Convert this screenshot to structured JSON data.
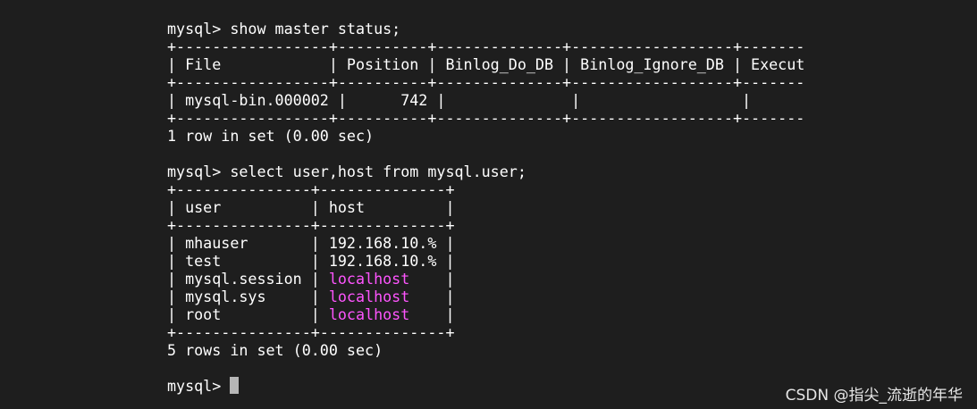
{
  "terminal": {
    "prompt": "mysql> ",
    "colors": {
      "background": "#1e1e1e",
      "text": "#ffffff",
      "localhost": "#ff55ff",
      "cursor": "#b6b6b6"
    },
    "cmd1": "show master status;",
    "master_status": {
      "border": "+-----------------+----------+--------------+------------------+-------",
      "header_row": "| File            | Position | Binlog_Do_DB | Binlog_Ignore_DB | Execut",
      "data_row": "| mysql-bin.000002 |      742 |              |                  |",
      "footer": "1 row in set (0.00 sec)"
    },
    "cmd2": "select user,host from mysql.user;",
    "users_table": {
      "border": "+---------------+--------------+",
      "header_row": "| user          | host         |",
      "rows": [
        {
          "pre": "| mhauser       | ",
          "host": "192.168.10.%",
          "post": " |"
        },
        {
          "pre": "| test          | ",
          "host": "192.168.10.%",
          "post": " |"
        },
        {
          "pre": "| mysql.session | ",
          "host": "localhost",
          "post": "    |"
        },
        {
          "pre": "| mysql.sys     | ",
          "host": "localhost",
          "post": "    |"
        },
        {
          "pre": "| root          | ",
          "host": "localhost",
          "post": "    |"
        }
      ],
      "footer": "5 rows in set (0.00 sec)"
    }
  },
  "watermark": "CSDN @指尖_流逝的年华"
}
